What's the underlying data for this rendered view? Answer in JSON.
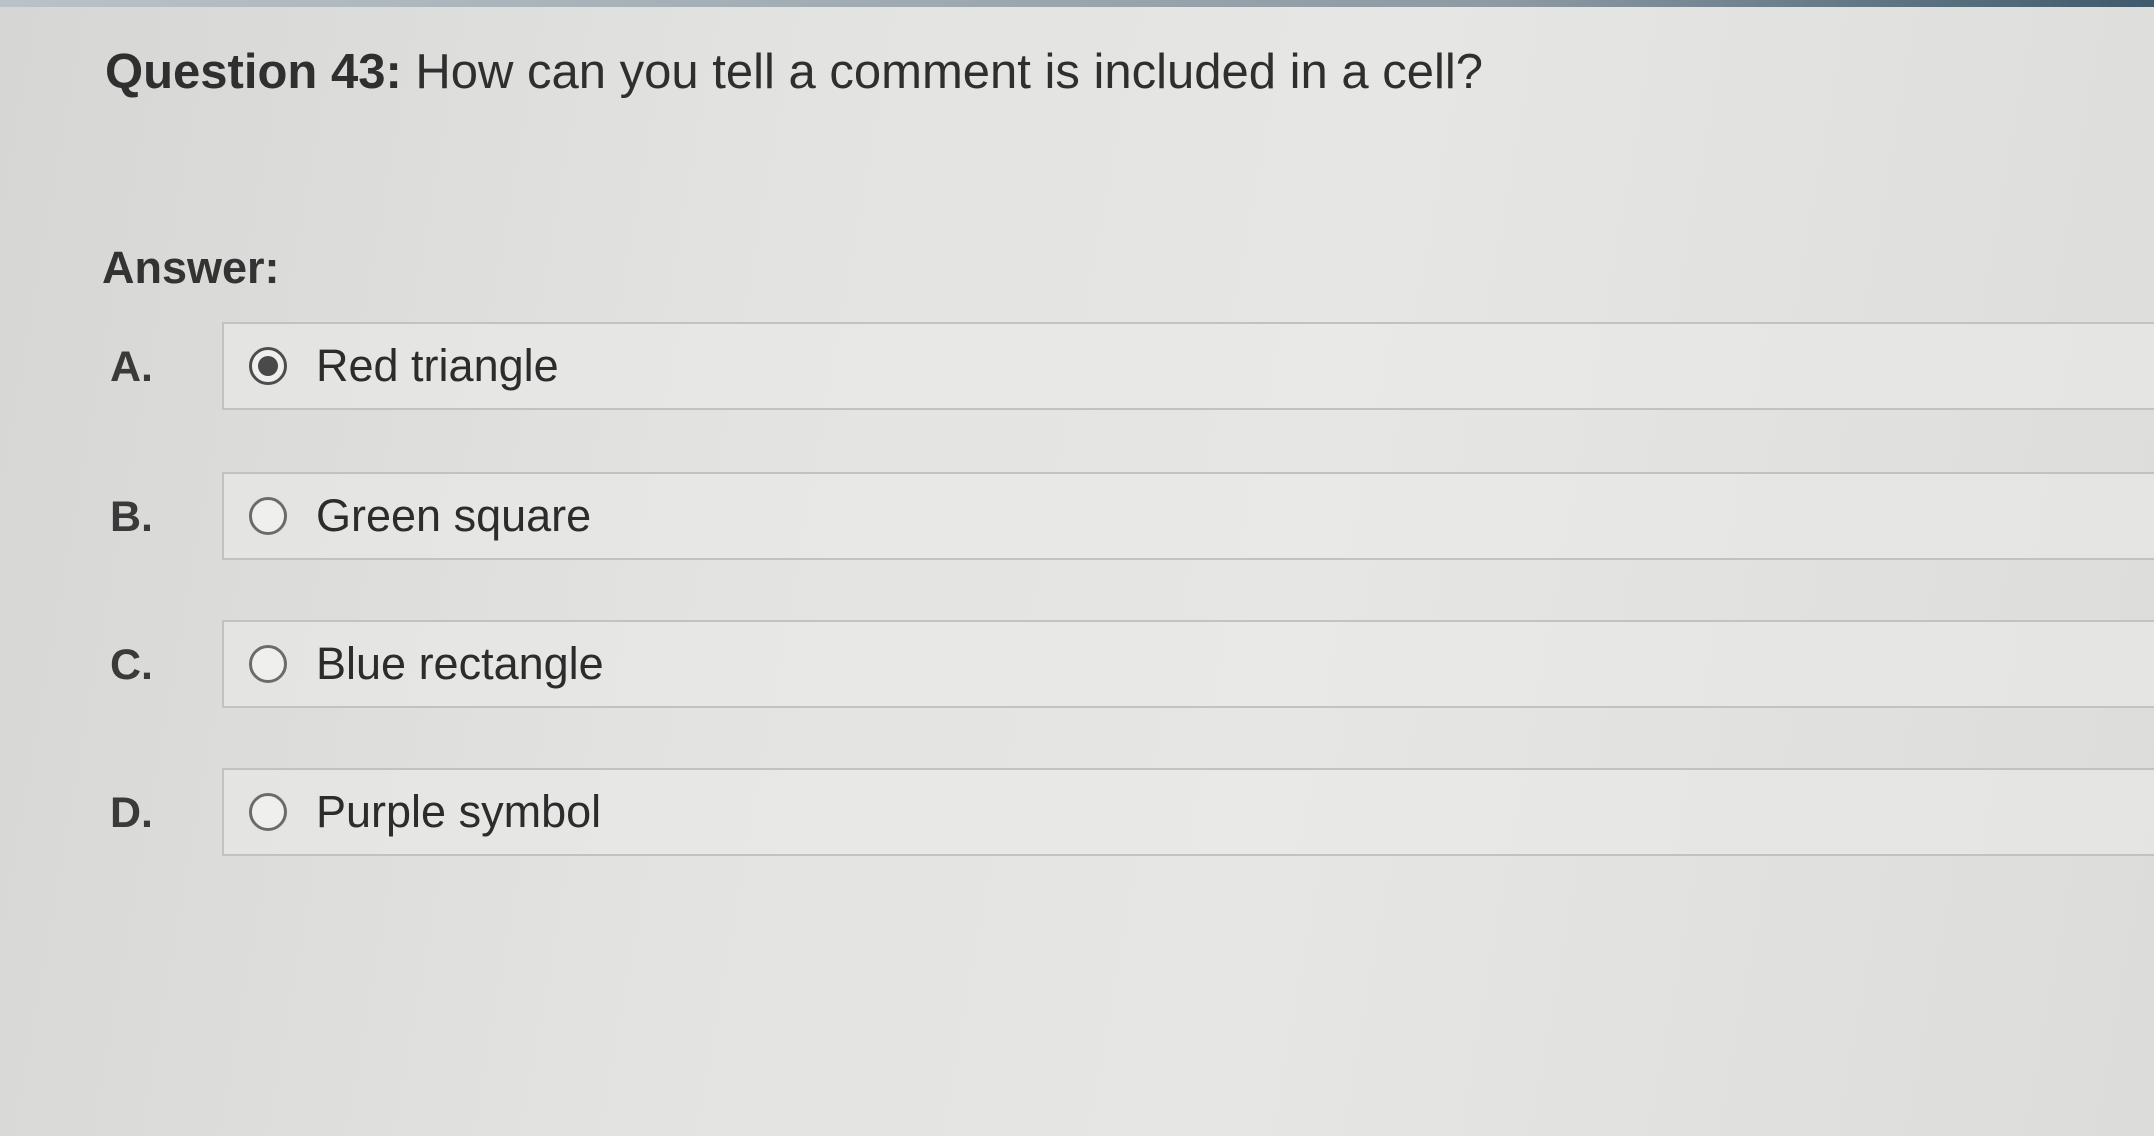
{
  "question": {
    "number": "Question 43:",
    "text": "How can you tell a comment is included in a cell?"
  },
  "answer_label": "Answer:",
  "options": [
    {
      "letter": "A.",
      "text": "Red triangle",
      "selected": true
    },
    {
      "letter": "B.",
      "text": "Green square",
      "selected": false
    },
    {
      "letter": "C.",
      "text": "Blue rectangle",
      "selected": false
    },
    {
      "letter": "D.",
      "text": "Purple symbol",
      "selected": false
    }
  ],
  "colors": {
    "accent_bar": "#3f5a6c",
    "radio_selected": "#4a4a4a"
  }
}
